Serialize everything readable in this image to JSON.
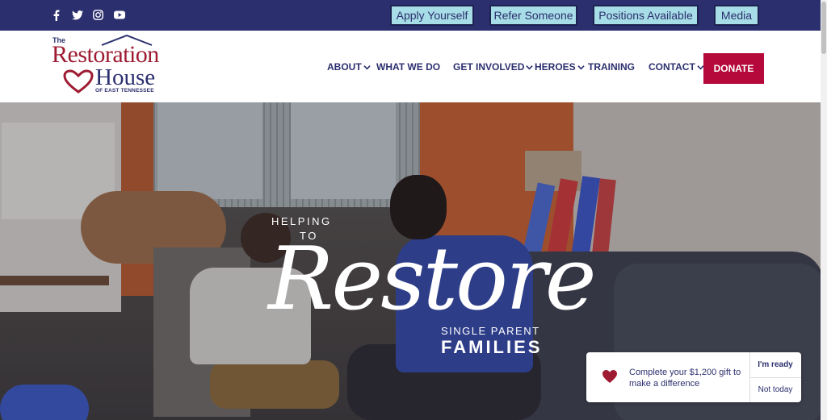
{
  "topbar": {
    "social": [
      {
        "name": "facebook-icon",
        "glyph": "f"
      },
      {
        "name": "twitter-icon",
        "glyph": "🐦"
      },
      {
        "name": "instagram-icon",
        "glyph": "◎"
      },
      {
        "name": "youtube-icon",
        "glyph": "▶"
      }
    ],
    "buttons": {
      "apply": "Apply Yourself",
      "refer": "Refer Someone",
      "positions": "Positions Available",
      "media": "Media"
    }
  },
  "logo": {
    "the": "The",
    "word1": "Restoration",
    "word2": "House",
    "sub": "OF EAST TENNESSEE"
  },
  "nav": {
    "about": "ABOUT",
    "what": "WHAT WE DO",
    "involved": "GET INVOLVED",
    "heroes": "HEROES",
    "training": "TRAINING",
    "contact": "CONTACT",
    "donate": "DONATE"
  },
  "hero": {
    "helping": "HELPING",
    "to": "TO",
    "restore": "Restore",
    "single": "SINGLE PARENT",
    "families": "FAMILIES"
  },
  "popup": {
    "message": "Complete your $1,200 gift to make a difference",
    "ready": "I'm ready",
    "not_today": "Not today"
  },
  "colors": {
    "navy": "#2b2f6e",
    "brand_red": "#9e1b32",
    "donate_red": "#b5093b",
    "button_teal": "#a7dde6"
  }
}
